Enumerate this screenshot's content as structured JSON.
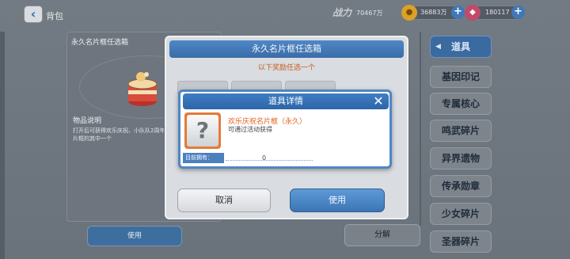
{
  "topbar": {
    "back_glyph": "‹",
    "title": "背包",
    "power_label": "战力",
    "power_value": "70467万",
    "gold_value": "36883万",
    "gem_value": "180117",
    "plus_glyph": "+"
  },
  "left_panel": {
    "title": "永久名片框任选箱",
    "desc_title": "物品说明",
    "desc_text": "打开后可获得欢乐庆祝、小队队2周年名片框的其中一个"
  },
  "bottom": {
    "use_label": "使用",
    "split_label": "分解"
  },
  "nav": {
    "items": [
      "道具",
      "基因印记",
      "专属核心",
      "鸣武碎片",
      "异界遗物",
      "传承勋章",
      "少女碎片",
      "圣器碎片"
    ],
    "active_index": 0,
    "active_arrow": "◀"
  },
  "chooser": {
    "title": "永久名片框任选箱",
    "subtitle": "以下奖励任选一个",
    "cancel_label": "取消",
    "use_label": "使用"
  },
  "detail": {
    "title": "道具详情",
    "close_glyph": "✕",
    "icon_glyph": "?",
    "item_name": "欢乐庆祝名片框（永久）",
    "item_source": "可通过活动获得",
    "owned_label": "目前拥有：",
    "owned_value": "0"
  },
  "colors": {
    "accent_blue": "#3f7dc3",
    "highlight_orange": "#e2641d"
  }
}
